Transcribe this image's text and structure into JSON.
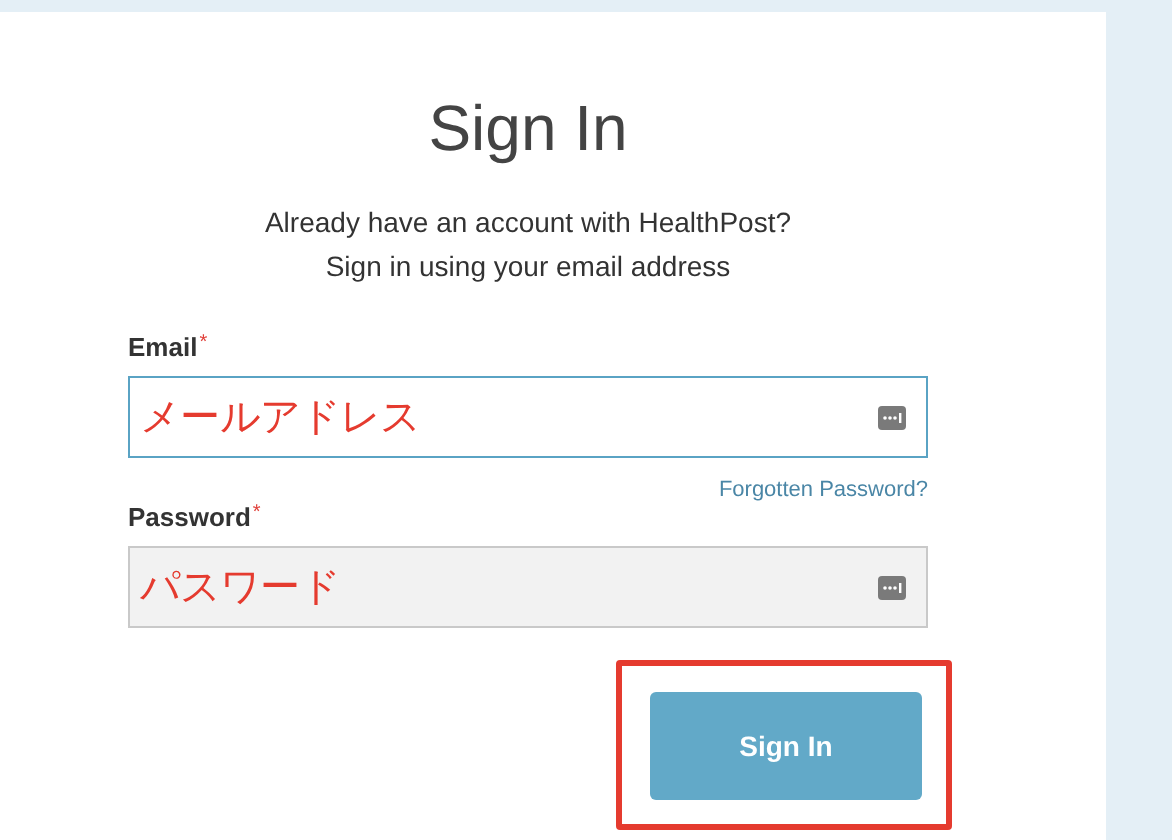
{
  "title": "Sign In",
  "intro": [
    "Already have an account with HealthPost?",
    "Sign in using your email address"
  ],
  "fields": [
    {
      "label": "Email",
      "required_mark": "*",
      "value": "メールアドレス",
      "focused": true
    },
    {
      "label": "Password",
      "required_mark": "*",
      "value": "パスワード",
      "focused": false
    }
  ],
  "forgot_link": "Forgotten Password?",
  "submit": {
    "label": "Sign In",
    "highlighted": true
  }
}
